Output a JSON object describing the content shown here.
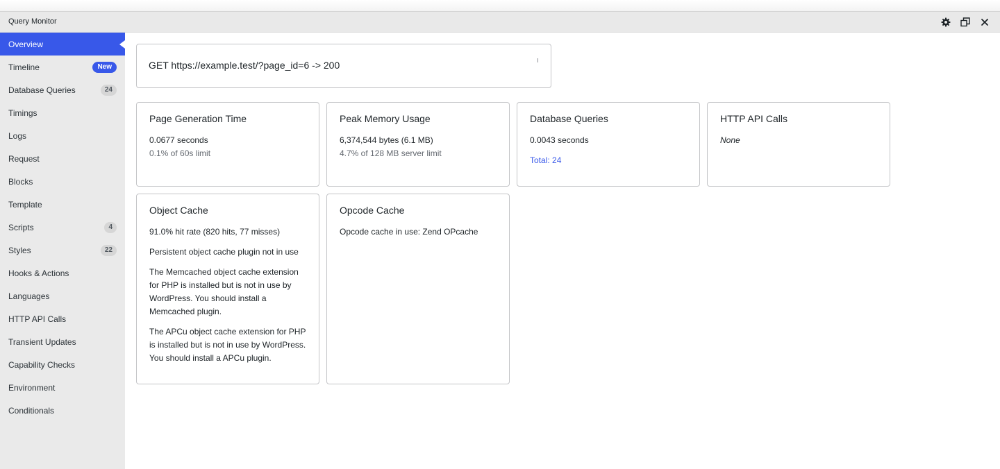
{
  "window": {
    "title": "Query Monitor",
    "controls": [
      "gear-icon",
      "popout-icon",
      "close-icon"
    ]
  },
  "sidebar": {
    "items": [
      {
        "label": "Overview",
        "active": true
      },
      {
        "label": "Timeline",
        "badge": "New"
      },
      {
        "label": "Database Queries",
        "badge": "24"
      },
      {
        "label": "Timings"
      },
      {
        "label": "Logs"
      },
      {
        "label": "Request"
      },
      {
        "label": "Blocks"
      },
      {
        "label": "Template"
      },
      {
        "label": "Scripts",
        "badge": "4"
      },
      {
        "label": "Styles",
        "badge": "22"
      },
      {
        "label": "Hooks & Actions"
      },
      {
        "label": "Languages"
      },
      {
        "label": "HTTP API Calls"
      },
      {
        "label": "Transient Updates"
      },
      {
        "label": "Capability Checks"
      },
      {
        "label": "Environment"
      },
      {
        "label": "Conditionals"
      }
    ]
  },
  "request": {
    "summary": "GET https://example.test/?page_id=6 -> 200"
  },
  "cards": {
    "page_generation": {
      "title": "Page Generation Time",
      "value": "0.0677 seconds",
      "detail": "0.1% of 60s limit"
    },
    "peak_memory": {
      "title": "Peak Memory Usage",
      "value": "6,374,544 bytes (6.1 MB)",
      "detail": "4.7% of 128 MB server limit"
    },
    "database_queries": {
      "title": "Database Queries",
      "value": "0.0043 seconds",
      "link": "Total: 24"
    },
    "http_api": {
      "title": "HTTP API Calls",
      "value": "None"
    },
    "object_cache": {
      "title": "Object Cache",
      "hit_rate": "91.0% hit rate (820 hits, 77 misses)",
      "persistent": "Persistent object cache plugin not in use",
      "memcached_note": "The Memcached object cache extension for PHP is installed but is not in use by WordPress. You should install a Memcached plugin.",
      "apcu_note": "The APCu object cache extension for PHP is installed but is not in use by WordPress. You should install a APCu plugin."
    },
    "opcode_cache": {
      "title": "Opcode Cache",
      "value": "Opcode cache in use: Zend OPcache"
    }
  },
  "colors": {
    "accent": "#3858e9",
    "sidebar_bg": "#eaeaea",
    "titlebar_bg": "#e9e9e9",
    "card_border": "#c3c4c7"
  }
}
